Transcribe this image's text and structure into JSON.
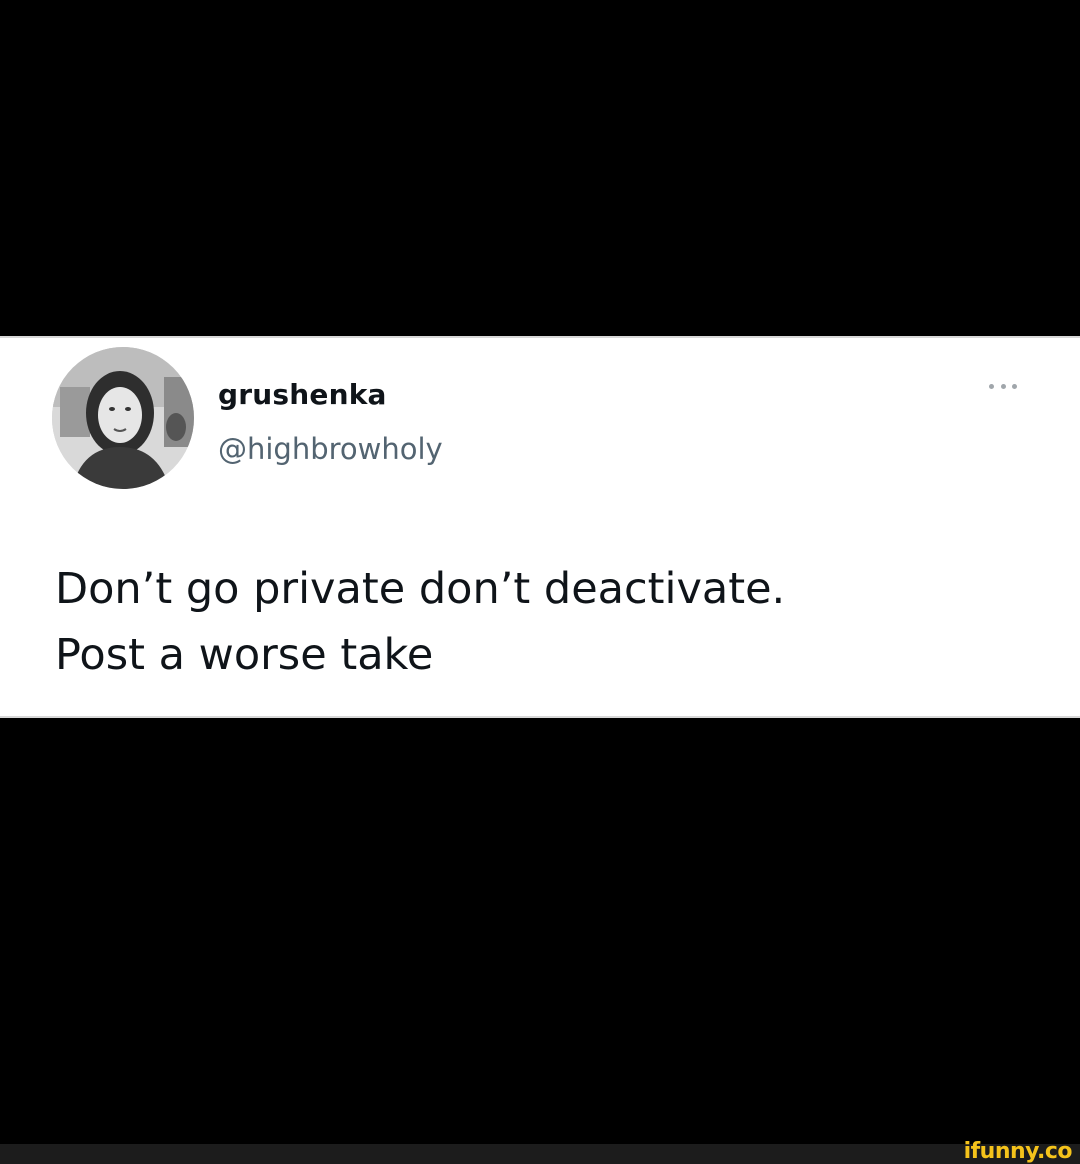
{
  "tweet": {
    "display_name": "grushenka",
    "handle": "@highbrowholy",
    "text_lines": [
      "Don’t go private don’t deactivate.",
      "Post a worse take"
    ],
    "more_icon": "more-horizontal-icon",
    "avatar": "profile-photo-grayscale"
  },
  "watermark": {
    "text": "ifunny.co",
    "color": "#f5c31b"
  },
  "colors": {
    "background": "#000000",
    "card": "#ffffff",
    "name": "#0f1419",
    "handle": "#536471"
  }
}
